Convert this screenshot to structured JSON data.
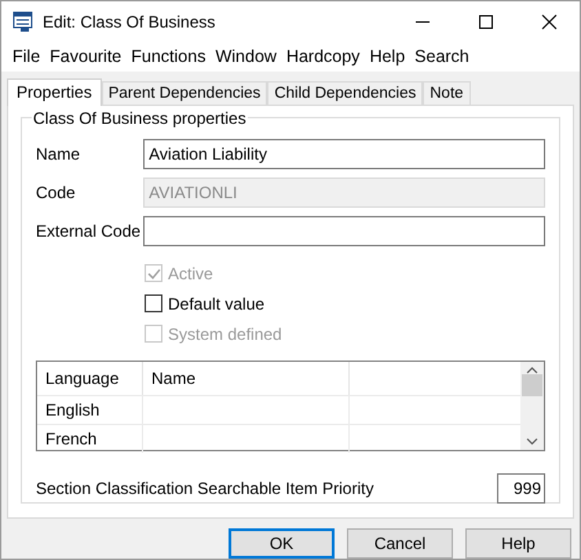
{
  "window": {
    "title": "Edit: Class Of Business"
  },
  "menu": [
    "File",
    "Favourite",
    "Functions",
    "Window",
    "Hardcopy",
    "Help",
    "Search"
  ],
  "tabs": [
    {
      "label": "Properties",
      "selected": true
    },
    {
      "label": "Parent Dependencies",
      "selected": false
    },
    {
      "label": "Child Dependencies",
      "selected": false
    },
    {
      "label": "Note",
      "selected": false
    }
  ],
  "group": {
    "title": "Class Of Business properties"
  },
  "fields": [
    {
      "label": "Name",
      "value": "Aviation Liability",
      "disabled": false
    },
    {
      "label": "Code",
      "value": "AVIATIONLI",
      "disabled": true
    },
    {
      "label": "External Code",
      "disabled": false
    }
  ],
  "checkboxes": [
    {
      "label": "Active",
      "checked": true,
      "disabled": true
    },
    {
      "label": "Default value",
      "checked": false,
      "disabled": false
    },
    {
      "label": "System defined",
      "checked": false,
      "disabled": true
    }
  ],
  "table": {
    "columns": [
      "Language",
      "Name"
    ],
    "rows": [
      [
        "English"
      ],
      [
        "French"
      ]
    ]
  },
  "priority": {
    "label": "Section Classification Searchable Item Priority",
    "value": "999"
  },
  "buttons": [
    {
      "label": "OK",
      "selected": true
    },
    {
      "label": "Cancel",
      "selected": false
    },
    {
      "label": "Help",
      "selected": false
    }
  ]
}
